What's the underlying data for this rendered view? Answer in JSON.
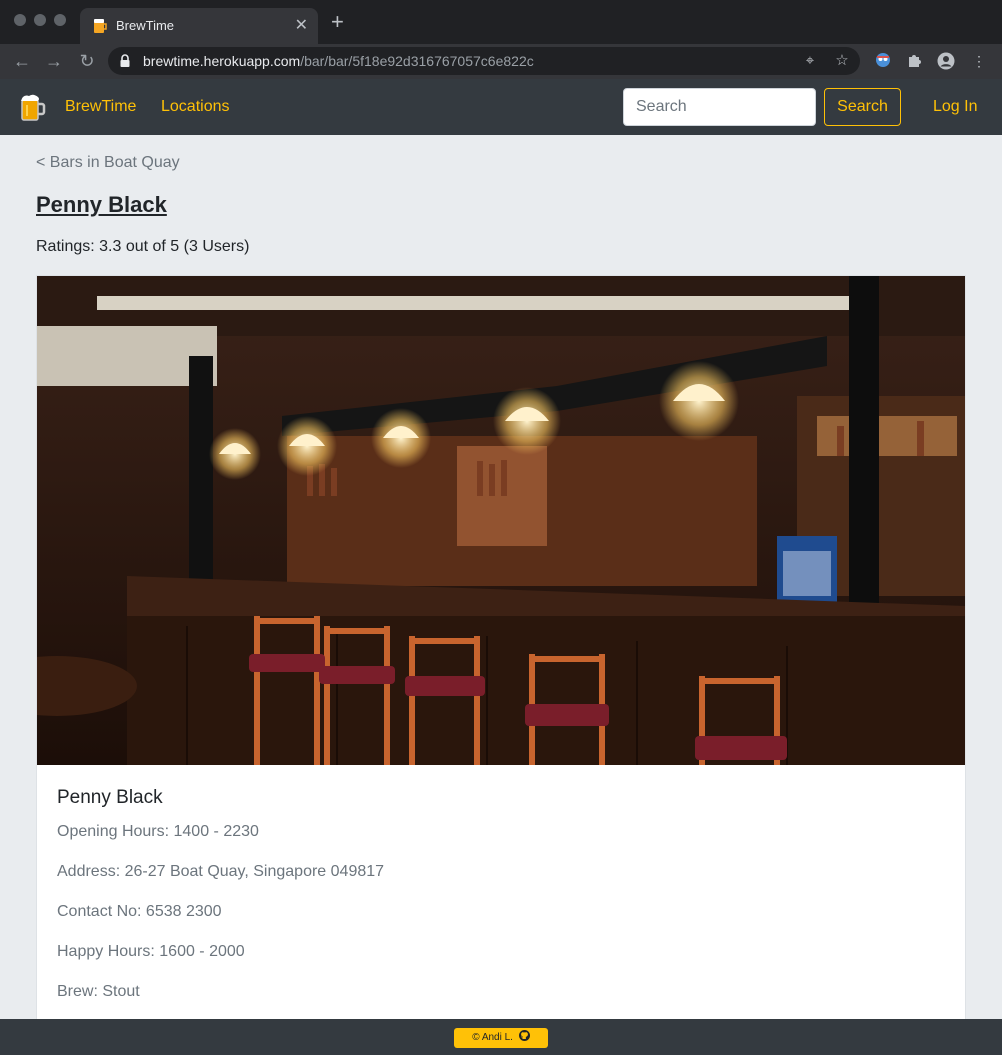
{
  "browser": {
    "tab_title": "BrewTime",
    "tab_close": "✕",
    "new_tab": "+",
    "url_host": "brewtime.herokuapp.com",
    "url_path": "/bar/bar/5f18e92d316767057c6e822c"
  },
  "navbar": {
    "brand": "BrewTime",
    "locations": "Locations",
    "search_placeholder": "Search",
    "search_button": "Search",
    "login": "Log In"
  },
  "page": {
    "back_link": "< Bars in Boat Quay",
    "title": "Penny Black",
    "ratings": "Ratings: 3.3 out of 5 (3 Users)"
  },
  "card": {
    "title": "Penny Black",
    "opening_hours": "Opening Hours: 1400 - 2230",
    "address": "Address: 26-27 Boat Quay, Singapore 049817",
    "contact": "Contact No: 6538 2300",
    "happy_hours": "Happy Hours: 1600 - 2000",
    "brew": "Brew: Stout"
  },
  "footer": {
    "credit": "© Andi L."
  },
  "colors": {
    "accent": "#ffc107",
    "navbar": "#343a40",
    "page_bg": "#e9ecef"
  }
}
